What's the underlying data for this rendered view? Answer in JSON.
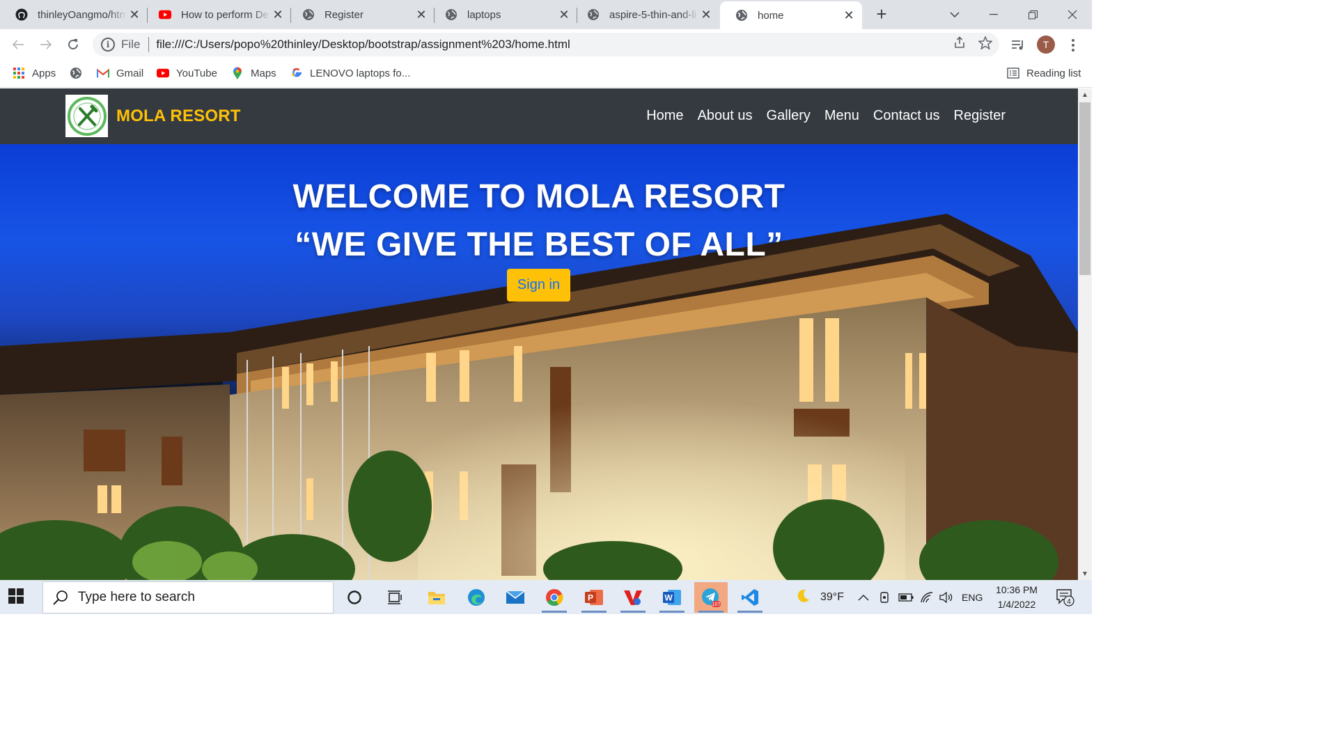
{
  "browser": {
    "tabs": [
      {
        "title": "thinleyOangmo/htm",
        "icon": "github-icon"
      },
      {
        "title": "How to perform De",
        "icon": "youtube-icon"
      },
      {
        "title": "Register",
        "icon": "globe-icon"
      },
      {
        "title": "laptops",
        "icon": "globe-icon"
      },
      {
        "title": "aspire-5-thin-and-li",
        "icon": "globe-icon"
      },
      {
        "title": "home",
        "icon": "globe-icon",
        "active": true
      }
    ],
    "address": {
      "scheme_label": "File",
      "url": "file:///C:/Users/popo%20thinley/Desktop/bootstrap/assignment%203/home.html"
    },
    "profile_initial": "T",
    "bookmarks": [
      {
        "label": "Apps",
        "icon": "apps-grid-icon"
      },
      {
        "label": "",
        "icon": "globe-icon"
      },
      {
        "label": "Gmail",
        "icon": "gmail-icon"
      },
      {
        "label": "YouTube",
        "icon": "youtube-icon"
      },
      {
        "label": "Maps",
        "icon": "maps-pin-icon"
      },
      {
        "label": "LENOVO laptops fo...",
        "icon": "google-icon"
      }
    ],
    "reading_list": "Reading list"
  },
  "site": {
    "brand": "MOLA RESORT",
    "nav": [
      "Home",
      "About us",
      "Gallery",
      "Menu",
      "Contact us",
      "Register"
    ],
    "hero": {
      "line1": "WELCOME TO MOLA RESORT",
      "line2": "“WE GIVE THE BEST OF ALL”",
      "button": "Sign in"
    },
    "colors": {
      "navbar": "#343a40",
      "brand": "#ffc107",
      "button_bg": "#ffc107",
      "button_text": "#0d6efd"
    }
  },
  "taskbar": {
    "search_placeholder": "Type here to search",
    "weather": "39°F",
    "language": "ENG",
    "time": "10:36 PM",
    "date": "1/4/2022",
    "notification_count": "4",
    "telegram_badge": "107"
  }
}
